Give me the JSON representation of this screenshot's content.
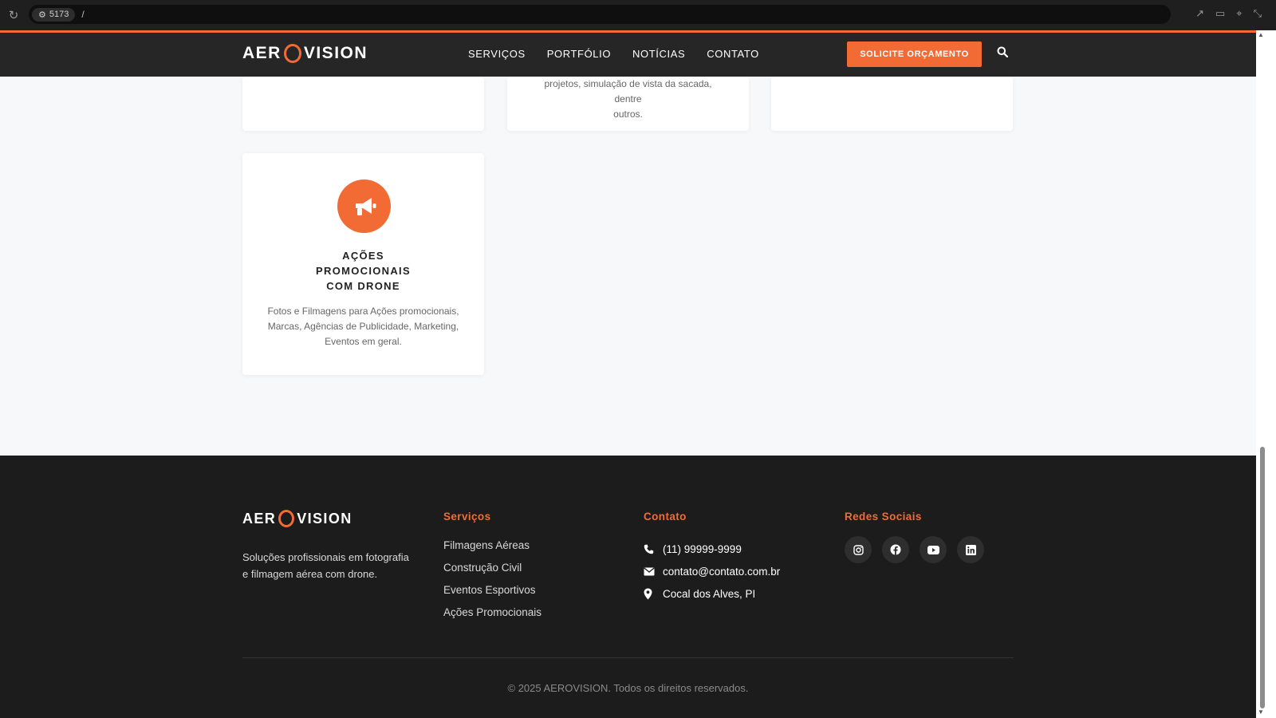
{
  "browser": {
    "port_label": "5173",
    "path": "/"
  },
  "header": {
    "logo_left": "AER",
    "logo_right": "VISION",
    "nav": [
      "SERVIÇOS",
      "PORTFÓLIO",
      "NOTÍCIAS",
      "CONTATO"
    ],
    "cta_label": "SOLICITE ORÇAMENTO"
  },
  "cards": {
    "partial_desc_lines": [
      "projetos, simulação de vista da sacada, dentre",
      "outros."
    ],
    "promo": {
      "icon": "megaphone-icon",
      "title": "AÇÕES PROMOCIONAIS COM DRONE",
      "description": "Fotos e Filmagens para Ações promocionais, Marcas, Agências de Publicidade, Marketing, Eventos em geral."
    }
  },
  "footer": {
    "logo_left": "AER",
    "logo_right": "VISION",
    "tagline": "Soluções profissionais em fotografia e filmagem aérea com drone.",
    "services_heading": "Serviços",
    "services": [
      "Filmagens Aéreas",
      "Construção Civil",
      "Eventos Esportivos",
      "Ações Promocionais"
    ],
    "contact_heading": "Contato",
    "phone": "(11) 99999-9999",
    "email": "contato@contato.com.br",
    "location": "Cocal dos Alves, PI",
    "social_heading": "Redes Sociais",
    "socials": [
      "instagram-icon",
      "facebook-icon",
      "youtube-icon",
      "linkedin-icon"
    ],
    "copyright": "© 2025 AEROVISION. Todos os direitos reservados."
  },
  "colors": {
    "accent": "#f26b35",
    "header_bg": "#262626",
    "footer_bg": "#1c1c1c",
    "page_bg": "#f7f8fa"
  }
}
